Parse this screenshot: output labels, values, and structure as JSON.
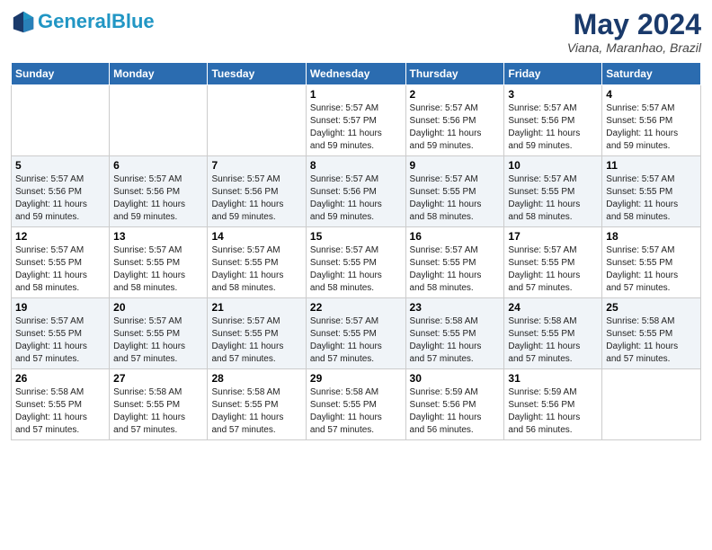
{
  "header": {
    "logo_general": "General",
    "logo_blue": "Blue",
    "month": "May 2024",
    "location": "Viana, Maranhao, Brazil"
  },
  "weekdays": [
    "Sunday",
    "Monday",
    "Tuesday",
    "Wednesday",
    "Thursday",
    "Friday",
    "Saturday"
  ],
  "weeks": [
    [
      {
        "day": "",
        "info": ""
      },
      {
        "day": "",
        "info": ""
      },
      {
        "day": "",
        "info": ""
      },
      {
        "day": "1",
        "info": "Sunrise: 5:57 AM\nSunset: 5:57 PM\nDaylight: 11 hours\nand 59 minutes."
      },
      {
        "day": "2",
        "info": "Sunrise: 5:57 AM\nSunset: 5:56 PM\nDaylight: 11 hours\nand 59 minutes."
      },
      {
        "day": "3",
        "info": "Sunrise: 5:57 AM\nSunset: 5:56 PM\nDaylight: 11 hours\nand 59 minutes."
      },
      {
        "day": "4",
        "info": "Sunrise: 5:57 AM\nSunset: 5:56 PM\nDaylight: 11 hours\nand 59 minutes."
      }
    ],
    [
      {
        "day": "5",
        "info": "Sunrise: 5:57 AM\nSunset: 5:56 PM\nDaylight: 11 hours\nand 59 minutes."
      },
      {
        "day": "6",
        "info": "Sunrise: 5:57 AM\nSunset: 5:56 PM\nDaylight: 11 hours\nand 59 minutes."
      },
      {
        "day": "7",
        "info": "Sunrise: 5:57 AM\nSunset: 5:56 PM\nDaylight: 11 hours\nand 59 minutes."
      },
      {
        "day": "8",
        "info": "Sunrise: 5:57 AM\nSunset: 5:56 PM\nDaylight: 11 hours\nand 59 minutes."
      },
      {
        "day": "9",
        "info": "Sunrise: 5:57 AM\nSunset: 5:55 PM\nDaylight: 11 hours\nand 58 minutes."
      },
      {
        "day": "10",
        "info": "Sunrise: 5:57 AM\nSunset: 5:55 PM\nDaylight: 11 hours\nand 58 minutes."
      },
      {
        "day": "11",
        "info": "Sunrise: 5:57 AM\nSunset: 5:55 PM\nDaylight: 11 hours\nand 58 minutes."
      }
    ],
    [
      {
        "day": "12",
        "info": "Sunrise: 5:57 AM\nSunset: 5:55 PM\nDaylight: 11 hours\nand 58 minutes."
      },
      {
        "day": "13",
        "info": "Sunrise: 5:57 AM\nSunset: 5:55 PM\nDaylight: 11 hours\nand 58 minutes."
      },
      {
        "day": "14",
        "info": "Sunrise: 5:57 AM\nSunset: 5:55 PM\nDaylight: 11 hours\nand 58 minutes."
      },
      {
        "day": "15",
        "info": "Sunrise: 5:57 AM\nSunset: 5:55 PM\nDaylight: 11 hours\nand 58 minutes."
      },
      {
        "day": "16",
        "info": "Sunrise: 5:57 AM\nSunset: 5:55 PM\nDaylight: 11 hours\nand 58 minutes."
      },
      {
        "day": "17",
        "info": "Sunrise: 5:57 AM\nSunset: 5:55 PM\nDaylight: 11 hours\nand 57 minutes."
      },
      {
        "day": "18",
        "info": "Sunrise: 5:57 AM\nSunset: 5:55 PM\nDaylight: 11 hours\nand 57 minutes."
      }
    ],
    [
      {
        "day": "19",
        "info": "Sunrise: 5:57 AM\nSunset: 5:55 PM\nDaylight: 11 hours\nand 57 minutes."
      },
      {
        "day": "20",
        "info": "Sunrise: 5:57 AM\nSunset: 5:55 PM\nDaylight: 11 hours\nand 57 minutes."
      },
      {
        "day": "21",
        "info": "Sunrise: 5:57 AM\nSunset: 5:55 PM\nDaylight: 11 hours\nand 57 minutes."
      },
      {
        "day": "22",
        "info": "Sunrise: 5:57 AM\nSunset: 5:55 PM\nDaylight: 11 hours\nand 57 minutes."
      },
      {
        "day": "23",
        "info": "Sunrise: 5:58 AM\nSunset: 5:55 PM\nDaylight: 11 hours\nand 57 minutes."
      },
      {
        "day": "24",
        "info": "Sunrise: 5:58 AM\nSunset: 5:55 PM\nDaylight: 11 hours\nand 57 minutes."
      },
      {
        "day": "25",
        "info": "Sunrise: 5:58 AM\nSunset: 5:55 PM\nDaylight: 11 hours\nand 57 minutes."
      }
    ],
    [
      {
        "day": "26",
        "info": "Sunrise: 5:58 AM\nSunset: 5:55 PM\nDaylight: 11 hours\nand 57 minutes."
      },
      {
        "day": "27",
        "info": "Sunrise: 5:58 AM\nSunset: 5:55 PM\nDaylight: 11 hours\nand 57 minutes."
      },
      {
        "day": "28",
        "info": "Sunrise: 5:58 AM\nSunset: 5:55 PM\nDaylight: 11 hours\nand 57 minutes."
      },
      {
        "day": "29",
        "info": "Sunrise: 5:58 AM\nSunset: 5:55 PM\nDaylight: 11 hours\nand 57 minutes."
      },
      {
        "day": "30",
        "info": "Sunrise: 5:59 AM\nSunset: 5:56 PM\nDaylight: 11 hours\nand 56 minutes."
      },
      {
        "day": "31",
        "info": "Sunrise: 5:59 AM\nSunset: 5:56 PM\nDaylight: 11 hours\nand 56 minutes."
      },
      {
        "day": "",
        "info": ""
      }
    ]
  ]
}
